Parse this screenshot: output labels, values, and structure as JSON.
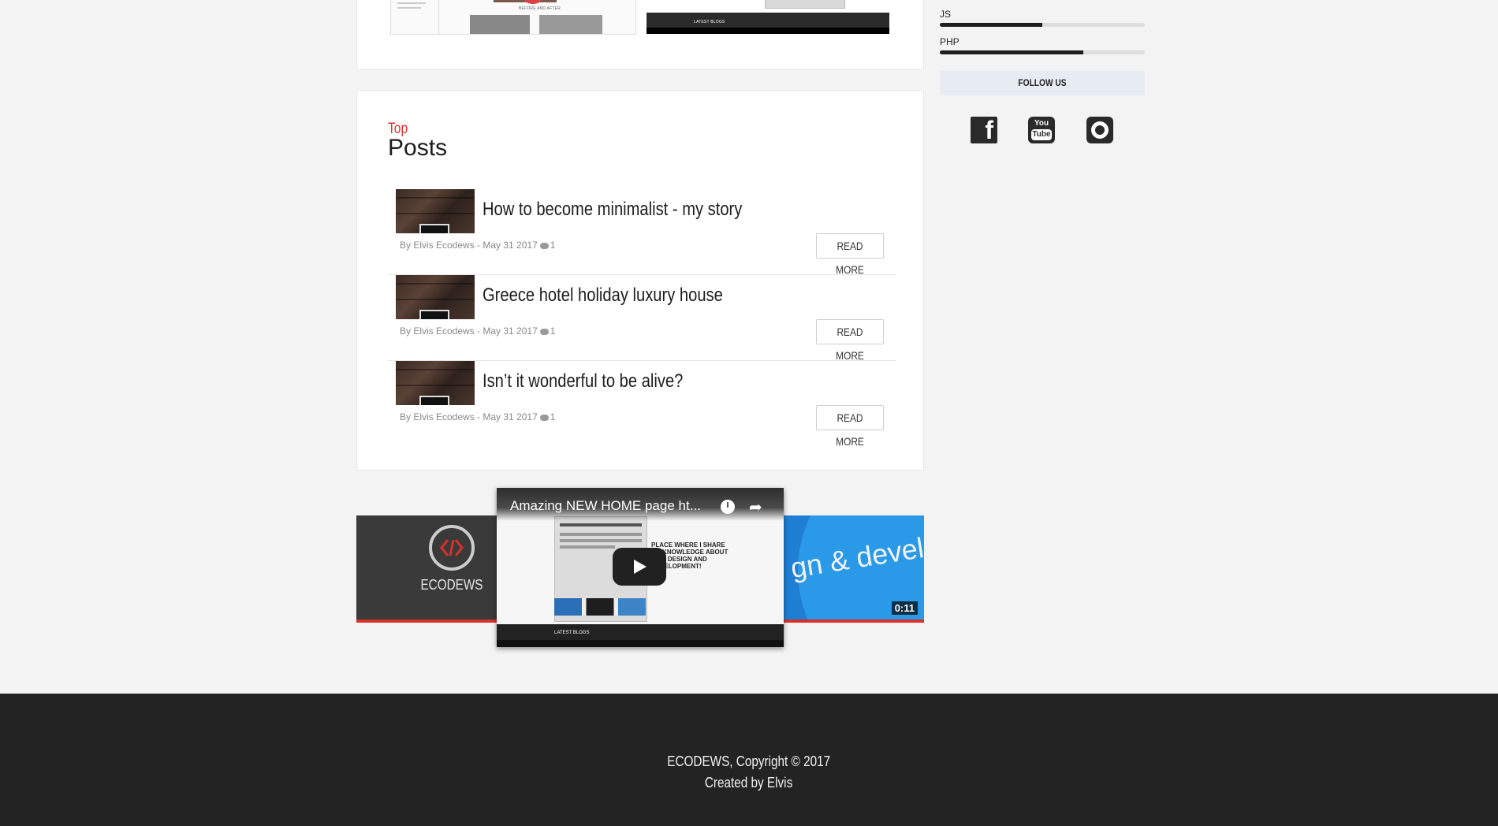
{
  "top_card": {
    "left_shot_label": "BEFORE AND AFTER",
    "right_shot_label": "LATEST BLOGS"
  },
  "top_posts": {
    "kicker": "Top",
    "title": "Posts",
    "posts": [
      {
        "title": "How to become minimalist - my story",
        "meta_prefix": "By Elvis Ecodews - May 31 2017",
        "comments": "1",
        "button": "READ MORE"
      },
      {
        "title": "Greece hotel holiday luxury house",
        "meta_prefix": "By Elvis Ecodews - May 31 2017",
        "comments": "1",
        "button": "READ MORE"
      },
      {
        "title": "Isn’t it wonderful to be alive?",
        "meta_prefix": "By Elvis Ecodews - May 31 2017",
        "comments": "1",
        "button": "READ MORE"
      }
    ]
  },
  "video": {
    "title": "Amazing NEW HOME page ht...",
    "logo_text": "ECODEWS",
    "banner_text": "gn & develop",
    "duration": "0:11",
    "shot_text": "PLACE WHERE I SHARE MY KNOWLEDGE ABOUT WEB DESIGN AND DEVELOPMENT!",
    "latest_label": "LATEST BLOGS"
  },
  "sidebar": {
    "skills": [
      {
        "label": "JS",
        "level": 0.5
      },
      {
        "label": "PHP",
        "level": 0.7
      }
    ],
    "follow_label": "FOLLOW US",
    "social": [
      "facebook-icon",
      "youtube-icon",
      "github-icon"
    ],
    "youtube_you": "You",
    "youtube_tube": "Tube",
    "facebook_letter": "f"
  },
  "footer": {
    "copyright": "ECODEWS, Copyright © 2017",
    "credit": "Created by Elvis"
  },
  "colors": {
    "accent": "#d9312a",
    "footer_bg": "#232323",
    "follow_bg": "#e7ecf3"
  }
}
